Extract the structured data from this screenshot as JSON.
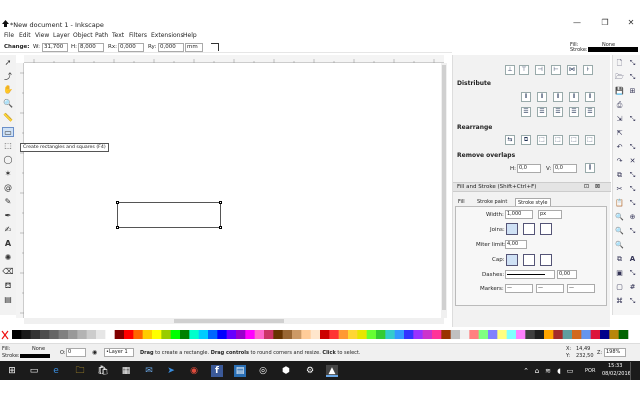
{
  "window": {
    "title": "*New document 1 - Inkscape",
    "controls": [
      "—",
      "❐",
      "✕"
    ]
  },
  "menu": [
    "File",
    "Edit",
    "View",
    "Layer",
    "Object",
    "Path",
    "Text",
    "Filters",
    "Extensions",
    "Help"
  ],
  "tool_controls": {
    "change_label": "Change:",
    "w_label": "W:",
    "w_value": "31,700",
    "h_label": "H:",
    "h_value": "8,000",
    "rx_label": "Rx:",
    "rx_value": "0,000",
    "ry_label": "Ry:",
    "ry_value": "0,000",
    "unit": "mm"
  },
  "style_indicator_top": {
    "fill_label": "Fill:",
    "stroke_label": "Stroke:",
    "fill_value": "None"
  },
  "tooltip": "Create rectangles and squares (F4)",
  "align_panel": {
    "distribute_heading": "Distribute",
    "rearrange_heading": "Rearrange",
    "remove_overlaps_heading": "Remove overlaps",
    "h_label": "H:",
    "h_value": "0,0",
    "v_label": "V:",
    "v_value": "0,0"
  },
  "fill_stroke": {
    "title": "Fill and Stroke (Shift+Ctrl+F)",
    "tabs": [
      "Fill",
      "Stroke paint",
      "Stroke style"
    ],
    "width_label": "Width:",
    "width_value": "1,000",
    "width_unit": "px",
    "joins_label": "Joins:",
    "miter_label": "Miter limit:",
    "miter_value": "4,00",
    "cap_label": "Cap:",
    "dashes_label": "Dashes:",
    "dashes_value": "0,00",
    "markers_label": "Markers:"
  },
  "statusbar": {
    "fill_label": "Fill:",
    "fill_value": "None",
    "stroke_label": "Stroke:",
    "opacity_label": "O:",
    "opacity_value": "0",
    "layer": "•Layer 1",
    "message_bold1": "Drag",
    "message_1": " to create a rectangle. ",
    "message_bold2": "Drag controls",
    "message_2": " to round corners and resize. ",
    "message_bold3": "Click",
    "message_3": " to select.",
    "x_label": "X:",
    "x_value": "14,49",
    "y_label": "Y:",
    "y_value": "232,50",
    "zoom_label": "Z:",
    "zoom_value": "198%"
  },
  "taskbar": {
    "time": "15:33",
    "date": "08/02/2016",
    "language": "POR"
  },
  "palette_colors": [
    "#000000",
    "#1a1a1a",
    "#333333",
    "#4d4d4d",
    "#666666",
    "#808080",
    "#999999",
    "#b3b3b3",
    "#cccccc",
    "#e6e6e6",
    "#ffffff",
    "#800000",
    "#ff0000",
    "#ff6600",
    "#ffcc00",
    "#ffff00",
    "#99cc00",
    "#00ff00",
    "#008000",
    "#00ffcc",
    "#00ccff",
    "#0066ff",
    "#0000ff",
    "#6600ff",
    "#9900cc",
    "#ff00ff",
    "#ff66cc",
    "#cc3366",
    "#663300",
    "#996633",
    "#cc9966",
    "#ffcc99",
    "#ffe6cc",
    "#cc0000",
    "#ff3333",
    "#ff9933",
    "#ffd633",
    "#e6e600",
    "#66ff33",
    "#33cc33",
    "#33cccc",
    "#3399ff",
    "#3333ff",
    "#9933ff",
    "#cc33cc",
    "#ff3399",
    "#993300",
    "#c0c0c0",
    "#f0f0f0",
    "#ff8080",
    "#80ff80",
    "#8080ff",
    "#ffff80",
    "#80ffff",
    "#ff80ff",
    "#404040",
    "#202020",
    "#ffa500",
    "#a52a2a",
    "#5f9ea0",
    "#d2691e",
    "#6495ed",
    "#dc143c",
    "#00008b",
    "#b8860b",
    "#006400"
  ]
}
